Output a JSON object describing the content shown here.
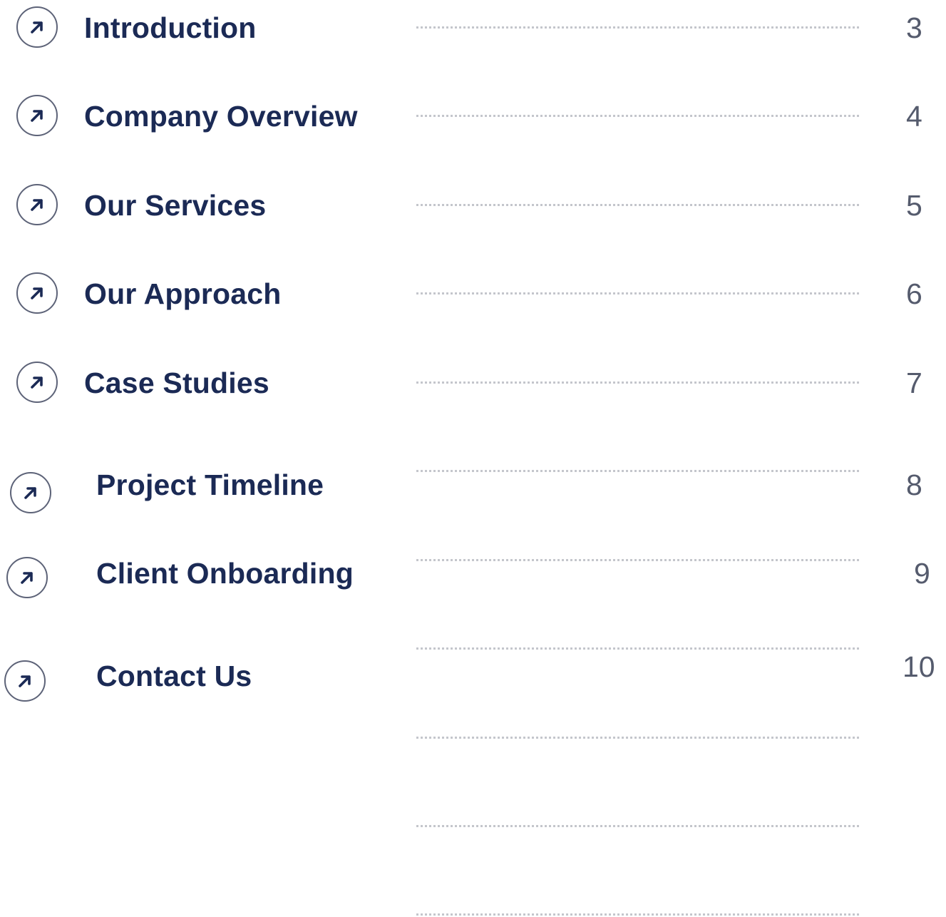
{
  "toc": {
    "entries": [
      {
        "title": "Introduction",
        "page": "3",
        "icon": "arrow-up-right-icon"
      },
      {
        "title": "Company Overview",
        "page": "4",
        "icon": "arrow-up-right-icon"
      },
      {
        "title": "Our Services",
        "page": "5",
        "icon": "arrow-up-right-icon"
      },
      {
        "title": "Our Approach",
        "page": "6",
        "icon": "arrow-up-right-icon"
      },
      {
        "title": "Case Studies",
        "page": "7",
        "icon": "arrow-up-right-icon"
      },
      {
        "title": "Project Timeline",
        "page": "8",
        "icon": "arrow-up-right-icon"
      },
      {
        "title": "Client Onboarding",
        "page": "9",
        "icon": "arrow-up-right-icon"
      },
      {
        "title": "Contact Us",
        "page": "10",
        "icon": "arrow-up-right-icon"
      }
    ],
    "colors": {
      "title": "#1b2a55",
      "page_number": "#555b6d",
      "icon_stroke": "#5d6378",
      "leader": "#c4c6cc"
    }
  }
}
